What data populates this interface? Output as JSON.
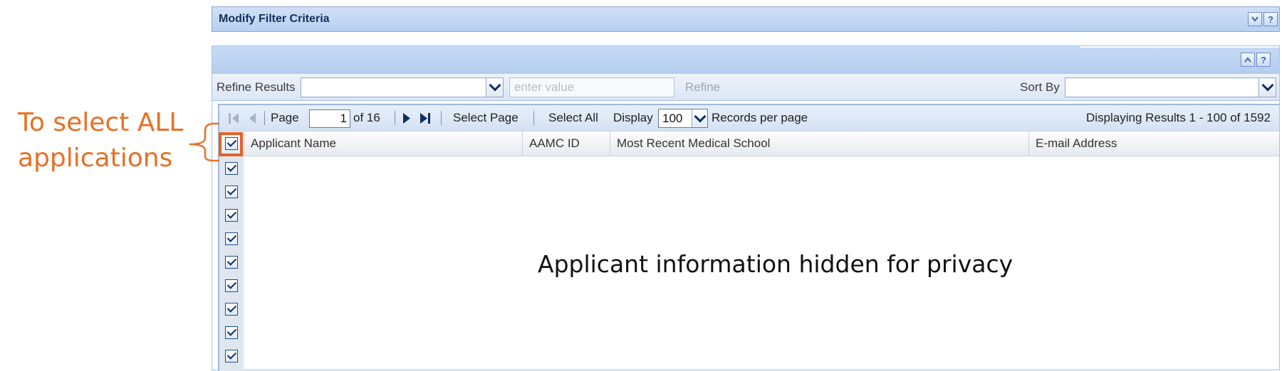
{
  "filter_panel": {
    "title": "Modify Filter Criteria",
    "collapse_icon": "chevron-down-icon",
    "help_label": "?"
  },
  "results_panel": {
    "collapse_icon": "chevron-up-icon",
    "help_label": "?"
  },
  "refine_bar": {
    "refine_label": "Refine Results",
    "refine_field_value": "",
    "value_placeholder": "enter value",
    "refine_button": "Refine",
    "sort_label": "Sort By",
    "sort_value": ""
  },
  "pager": {
    "page_label": "Page",
    "current_page": "1",
    "of_pages": "of 16",
    "select_page": "Select Page",
    "select_all": "Select All",
    "display_label": "Display",
    "per_page": "100",
    "records_label": "Records per page",
    "displaying": "Displaying Results 1 - 100 of 1592"
  },
  "columns": [
    "Applicant Name",
    "AAMC ID",
    "Most Recent Medical School",
    "E-mail Address"
  ],
  "rows_checked": [
    true,
    true,
    true,
    true,
    true,
    true,
    true,
    true,
    true
  ],
  "privacy_note": "Applicant information hidden for privacy",
  "annotation": {
    "text": "To select ALL\napplications",
    "color": "#e87025"
  },
  "colors": {
    "header_blue": "#b7d0f1",
    "accent_orange": "#e0642a"
  }
}
